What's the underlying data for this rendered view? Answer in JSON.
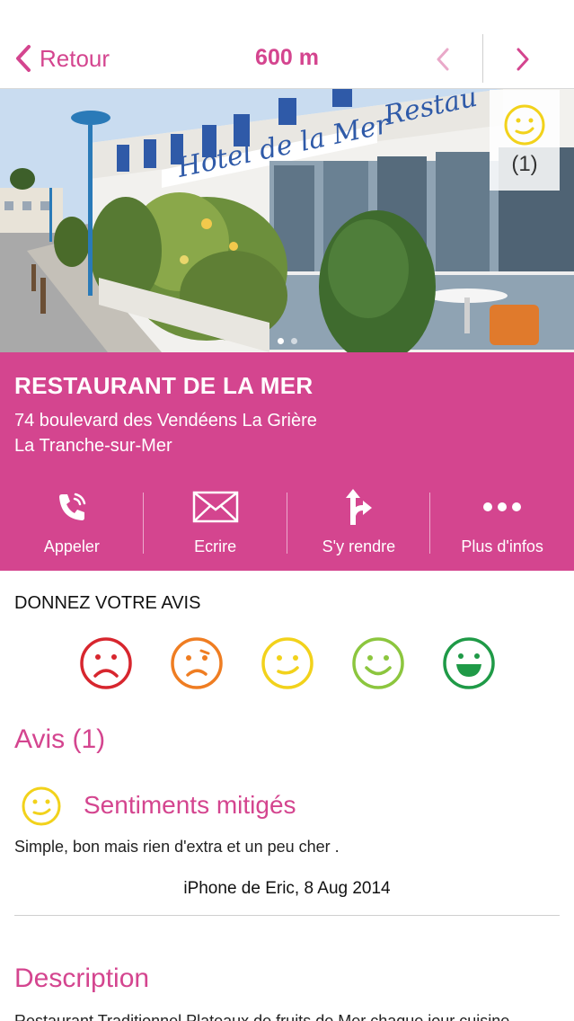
{
  "header": {
    "back_label": "Retour",
    "distance": "600 m"
  },
  "photo": {
    "rating_count": "(1)",
    "rating_icon": "neutral-smiley-icon",
    "sign_text_hotel": "Hôtel de la Mer",
    "sign_text_restaurant": "Restau"
  },
  "place": {
    "name": "RESTAURANT DE LA MER",
    "address_line1": "74 boulevard des Vendéens La Grière",
    "address_line2": "La Tranche-sur-Mer"
  },
  "actions": [
    {
      "label": "Appeler",
      "icon": "phone-icon"
    },
    {
      "label": "Ecrire",
      "icon": "envelope-icon"
    },
    {
      "label": "S'y rendre",
      "icon": "directions-icon"
    },
    {
      "label": "Plus d'infos",
      "icon": "more-icon"
    }
  ],
  "feedback": {
    "title": "DONNEZ VOTRE AVIS",
    "smileys": [
      {
        "icon": "very-sad-smiley-icon",
        "color": "#d7262e"
      },
      {
        "icon": "sad-smiley-icon",
        "color": "#ef7d22"
      },
      {
        "icon": "neutral-smiley-icon",
        "color": "#f2d21b"
      },
      {
        "icon": "happy-smiley-icon",
        "color": "#8cc63e"
      },
      {
        "icon": "very-happy-smiley-icon",
        "color": "#1f9a47"
      }
    ]
  },
  "reviews": {
    "title": "Avis (1)",
    "items": [
      {
        "sentiment": "Sentiments mitigés",
        "text": "Simple, bon mais rien d'extra et un peu cher .",
        "author_date": "iPhone de Eric, 8 Aug 2014"
      }
    ]
  },
  "description": {
    "title": "Description",
    "text": "Restaurant Traditionnel Plateaux de fruits de Mer chaque jour cuisine"
  },
  "colors": {
    "brand": "#d4458f",
    "neutral": "#f2d21b"
  }
}
